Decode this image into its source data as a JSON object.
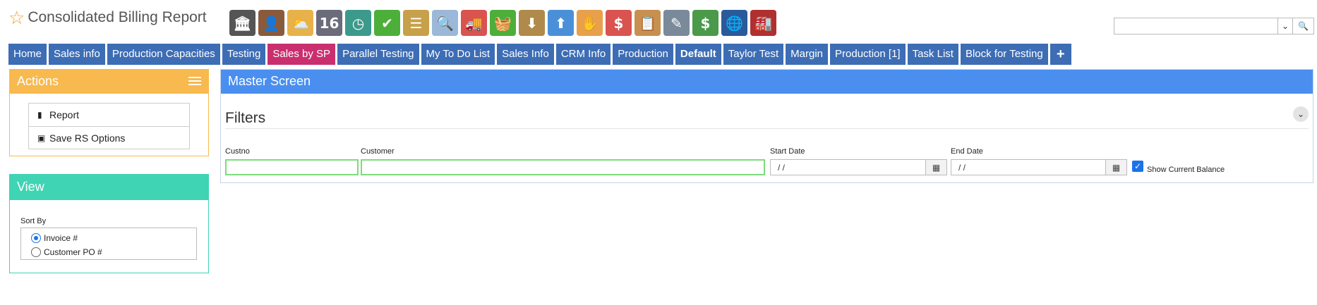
{
  "app": {
    "title": "Consolidated Billing Report"
  },
  "toolbar_icons": [
    {
      "name": "bank-icon",
      "glyph": "🏛",
      "color": "#555555"
    },
    {
      "name": "person-icon",
      "glyph": "👤",
      "color": "#8a5a3c"
    },
    {
      "name": "weather-icon",
      "glyph": "⛅",
      "color": "#e8b24a"
    },
    {
      "name": "calendar-icon",
      "glyph": "16",
      "color": "#6b6b7b"
    },
    {
      "name": "clock-icon",
      "glyph": "◷",
      "color": "#3c9a8c"
    },
    {
      "name": "checkmark-icon",
      "glyph": "✔",
      "color": "#4caf3a"
    },
    {
      "name": "list-icon",
      "glyph": "☰",
      "color": "#c7a04a"
    },
    {
      "name": "magnifier-icon",
      "glyph": "🔍",
      "color": "#9bb8d8"
    },
    {
      "name": "truck-icon",
      "glyph": "🚚",
      "color": "#d9534f"
    },
    {
      "name": "basket-icon",
      "glyph": "🧺",
      "color": "#4caf3a"
    },
    {
      "name": "inbox-download-icon",
      "glyph": "⬇",
      "color": "#b08a4a"
    },
    {
      "name": "outbox-upload-icon",
      "glyph": "⬆",
      "color": "#4a90d9"
    },
    {
      "name": "hand-payment-icon",
      "glyph": "✋",
      "color": "#e8a04a"
    },
    {
      "name": "dollar-chat-icon",
      "glyph": "$",
      "color": "#d9534f"
    },
    {
      "name": "clipboard-icon",
      "glyph": "📋",
      "color": "#c89050"
    },
    {
      "name": "pencil-icon",
      "glyph": "✎",
      "color": "#7a8a9a"
    },
    {
      "name": "money-icon",
      "glyph": "$",
      "color": "#4a9a4a"
    },
    {
      "name": "globe-book-icon",
      "glyph": "🌐",
      "color": "#2a5a9a"
    },
    {
      "name": "factory-icon",
      "glyph": "🏭",
      "color": "#b03030"
    }
  ],
  "search": {
    "value": "",
    "dropdown_glyph": "⌄",
    "button_glyph": "🔍"
  },
  "tabs": [
    {
      "label": "Home"
    },
    {
      "label": "Sales info"
    },
    {
      "label": "Production Capacities"
    },
    {
      "label": "Testing"
    },
    {
      "label": "Sales by SP",
      "active": true
    },
    {
      "label": "Parallel Testing"
    },
    {
      "label": "My To Do List"
    },
    {
      "label": "Sales Info"
    },
    {
      "label": "CRM Info"
    },
    {
      "label": "Production"
    },
    {
      "label": "Default",
      "bold": true
    },
    {
      "label": "Taylor Test"
    },
    {
      "label": "Margin"
    },
    {
      "label": "Production [1]"
    },
    {
      "label": "Task List"
    },
    {
      "label": "Block for Testing"
    },
    {
      "label": "+"
    }
  ],
  "actions": {
    "title": "Actions",
    "items": [
      {
        "label": "Report",
        "icon": "file-icon"
      },
      {
        "label": "Save RS Options",
        "icon": "save-icon"
      }
    ]
  },
  "view": {
    "title": "View",
    "sort_by_label": "Sort By",
    "options": [
      {
        "label": "Invoice #",
        "selected": true
      },
      {
        "label": "Customer PO #",
        "selected": false
      }
    ]
  },
  "master": {
    "title": "Master Screen",
    "filters_title": "Filters",
    "fields": {
      "custno_label": "Custno",
      "custno_value": "",
      "customer_label": "Customer",
      "customer_value": "",
      "start_date_label": "Start Date",
      "start_date_value": "/ /",
      "end_date_label": "End Date",
      "end_date_value": "/ /"
    },
    "show_current_balance_label": "Show Current Balance",
    "show_current_balance_checked": true
  },
  "colors": {
    "tab": "#3d6db5",
    "tab_active": "#c92f6e",
    "actions_header": "#f8b94e",
    "view_header": "#3fd4b4",
    "master_header": "#4a8ff0"
  }
}
